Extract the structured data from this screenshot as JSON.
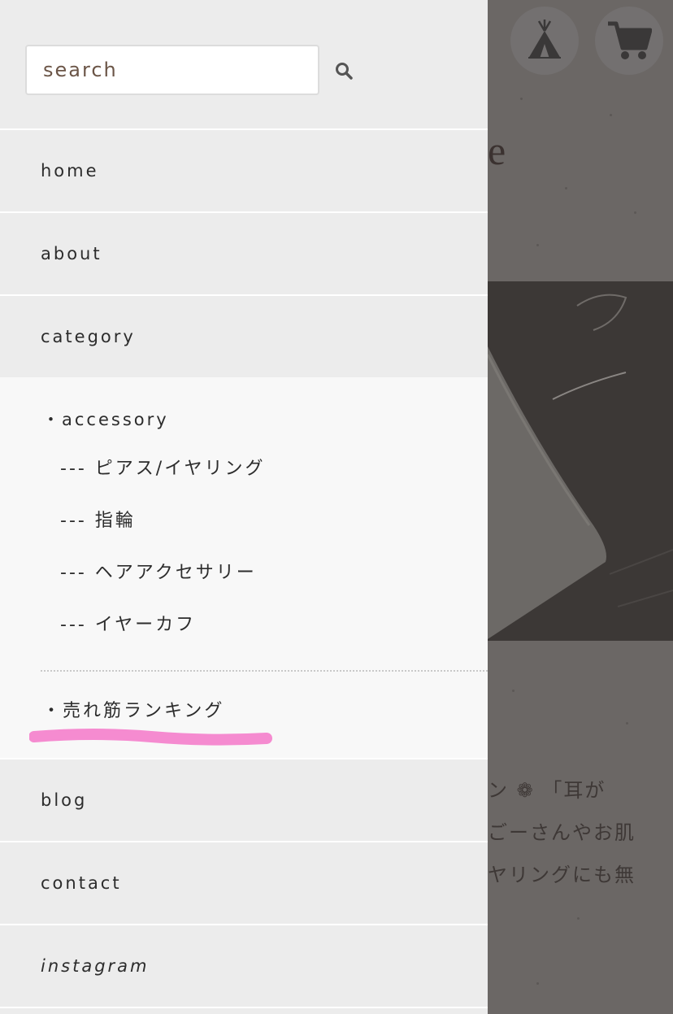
{
  "search": {
    "placeholder": "search"
  },
  "nav": {
    "home": "home",
    "about": "about",
    "category": "category",
    "blog": "blog",
    "contact": "contact",
    "instagram": "instagram"
  },
  "category_panel": {
    "accessory": "・accessory",
    "children": [
      "--- ピアス/イヤリング",
      "--- 指輪",
      "--- ヘアアクセサリー",
      "--- イヤーカフ"
    ],
    "ranking": "・売れ筋ランキング"
  },
  "background": {
    "heading_fragment": "e",
    "text_lines": [
      "ン ❁ 「耳が",
      "ごーさんやお肌",
      "ヤリングにも無"
    ]
  },
  "colors": {
    "menu_bg": "#ececec",
    "submenu_bg": "#f8f8f8",
    "overlay": "#5b5856",
    "search_text": "#6b5547",
    "highlight": "#f58bd0"
  },
  "icons": [
    "search-icon",
    "tent-icon",
    "cart-icon"
  ]
}
